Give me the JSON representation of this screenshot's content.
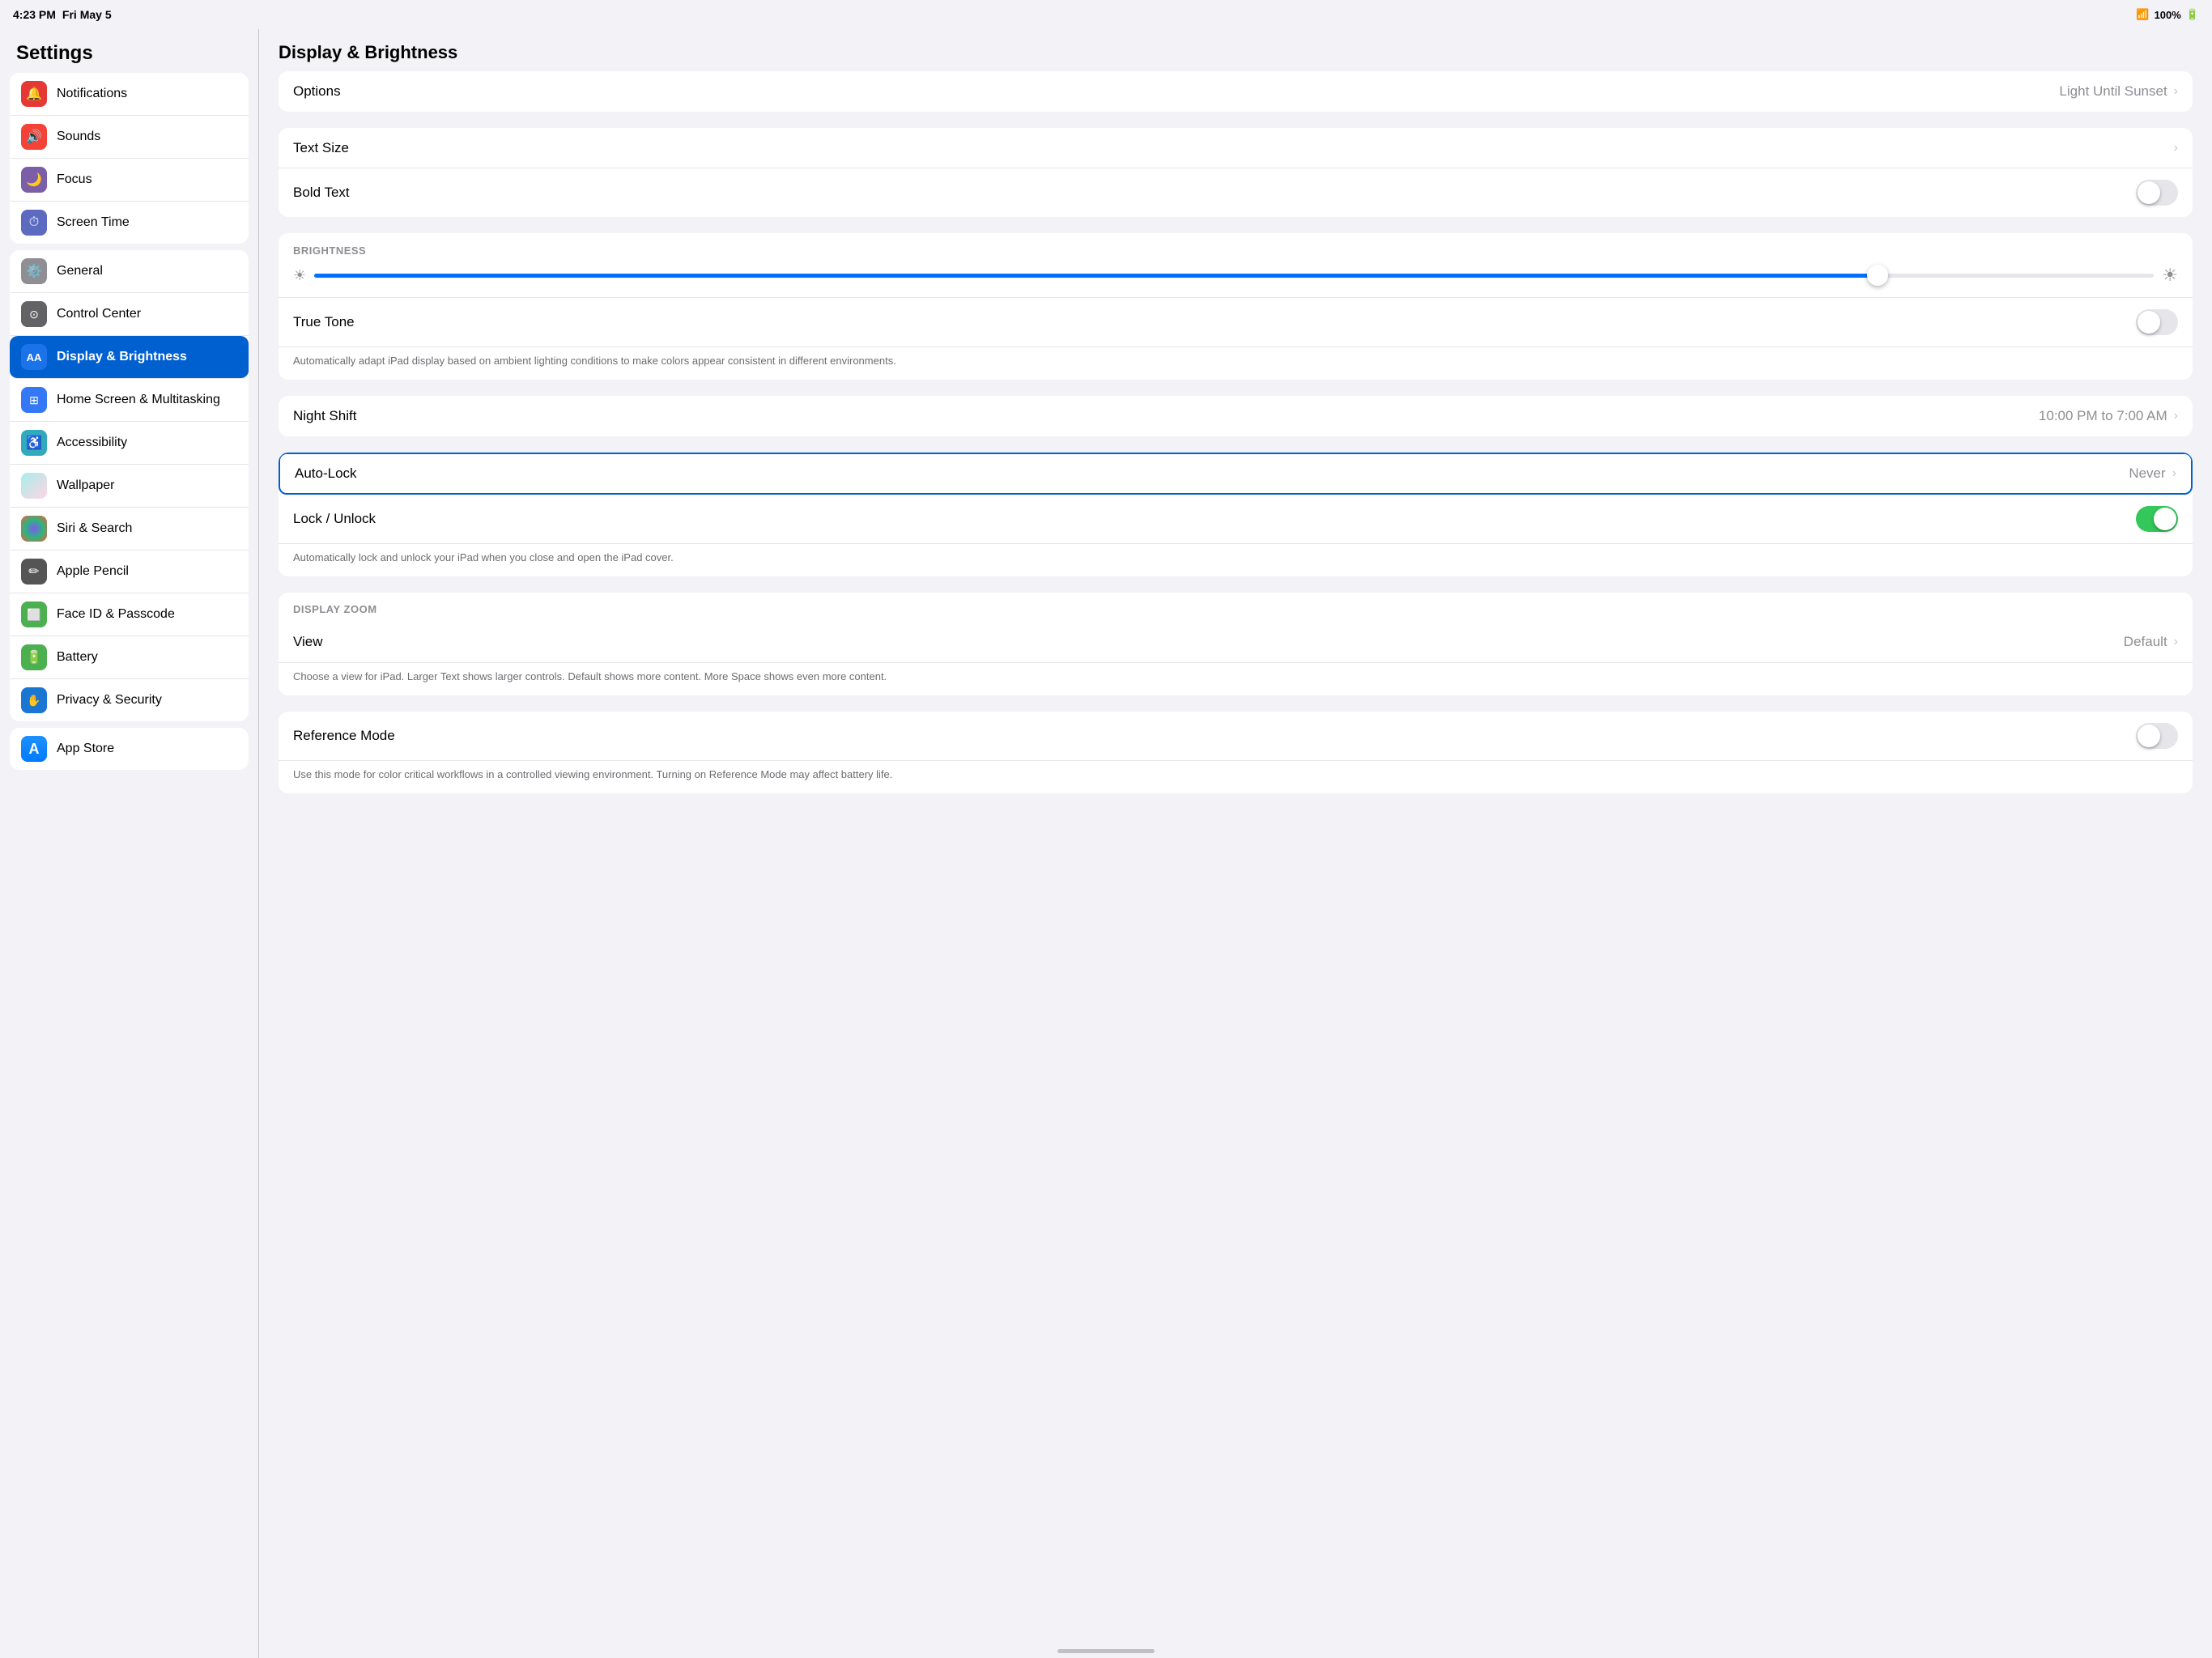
{
  "statusBar": {
    "time": "4:23 PM",
    "date": "Fri May 5",
    "wifi": "wifi",
    "battery": "100%"
  },
  "sidebar": {
    "title": "Settings",
    "groups": [
      {
        "id": "top",
        "items": [
          {
            "id": "notifications",
            "label": "Notifications",
            "icon": "🔔",
            "iconBg": "icon-red",
            "active": false
          },
          {
            "id": "sounds",
            "label": "Sounds",
            "icon": "🔊",
            "iconBg": "icon-orange-red",
            "active": false
          },
          {
            "id": "focus",
            "label": "Focus",
            "icon": "🌙",
            "iconBg": "icon-purple",
            "active": false
          },
          {
            "id": "screen-time",
            "label": "Screen Time",
            "icon": "⏱",
            "iconBg": "icon-indigo",
            "active": false
          }
        ]
      },
      {
        "id": "middle",
        "items": [
          {
            "id": "general",
            "label": "General",
            "icon": "⚙️",
            "iconBg": "icon-gray",
            "active": false
          },
          {
            "id": "control-center",
            "label": "Control Center",
            "icon": "◉",
            "iconBg": "icon-dark-gray",
            "active": false
          },
          {
            "id": "display-brightness",
            "label": "Display & Brightness",
            "icon": "AA",
            "iconBg": "icon-blue-aa",
            "active": true
          },
          {
            "id": "home-screen",
            "label": "Home Screen & Multitasking",
            "icon": "⊞",
            "iconBg": "icon-grid-blue",
            "active": false
          },
          {
            "id": "accessibility",
            "label": "Accessibility",
            "icon": "☺",
            "iconBg": "icon-teal",
            "active": false
          },
          {
            "id": "wallpaper",
            "label": "Wallpaper",
            "icon": "🖼",
            "iconBg": "icon-wallpaper",
            "active": false
          },
          {
            "id": "siri",
            "label": "Siri & Search",
            "icon": "◉",
            "iconBg": "icon-siri",
            "active": false
          },
          {
            "id": "apple-pencil",
            "label": "Apple Pencil",
            "icon": "✏",
            "iconBg": "icon-pencil",
            "active": false
          },
          {
            "id": "face-id",
            "label": "Face ID & Passcode",
            "icon": "◻",
            "iconBg": "icon-face-id",
            "active": false
          },
          {
            "id": "battery",
            "label": "Battery",
            "icon": "🔋",
            "iconBg": "icon-battery",
            "active": false
          },
          {
            "id": "privacy",
            "label": "Privacy & Security",
            "icon": "✋",
            "iconBg": "icon-privacy",
            "active": false
          }
        ]
      },
      {
        "id": "bottom",
        "items": [
          {
            "id": "app-store",
            "label": "App Store",
            "icon": "A",
            "iconBg": "icon-appstore",
            "active": false
          }
        ]
      }
    ]
  },
  "mainContent": {
    "title": "Display & Brightness",
    "groups": [
      {
        "id": "appearance",
        "rows": [
          {
            "id": "options",
            "label": "Options",
            "value": "Light Until Sunset",
            "hasChevron": true,
            "type": "nav"
          }
        ]
      },
      {
        "id": "text",
        "rows": [
          {
            "id": "text-size",
            "label": "Text Size",
            "value": "",
            "hasChevron": true,
            "type": "nav"
          },
          {
            "id": "bold-text",
            "label": "Bold Text",
            "value": "",
            "hasChevron": false,
            "type": "toggle",
            "toggleOn": false
          }
        ]
      },
      {
        "id": "brightness",
        "sectionLabel": "BRIGHTNESS",
        "rows": []
      },
      {
        "id": "truetone",
        "rows": [
          {
            "id": "true-tone",
            "label": "True Tone",
            "value": "",
            "hasChevron": false,
            "type": "toggle",
            "toggleOn": false
          },
          {
            "id": "true-tone-desc",
            "type": "description",
            "text": "Automatically adapt iPad display based on ambient lighting conditions to make colors appear consistent in different environments."
          }
        ]
      },
      {
        "id": "nightshift",
        "rows": [
          {
            "id": "night-shift",
            "label": "Night Shift",
            "value": "10:00 PM to 7:00 AM",
            "hasChevron": true,
            "type": "nav"
          }
        ]
      },
      {
        "id": "autolock",
        "rows": [
          {
            "id": "auto-lock",
            "label": "Auto-Lock",
            "value": "Never",
            "hasChevron": true,
            "type": "nav",
            "highlighted": true
          },
          {
            "id": "lock-unlock",
            "label": "Lock / Unlock",
            "value": "",
            "hasChevron": false,
            "type": "toggle",
            "toggleOn": true
          },
          {
            "id": "lock-unlock-desc",
            "type": "description",
            "text": "Automatically lock and unlock your iPad when you close and open the iPad cover."
          }
        ]
      },
      {
        "id": "displayzoom",
        "sectionLabel": "DISPLAY ZOOM",
        "rows": [
          {
            "id": "view",
            "label": "View",
            "value": "Default",
            "hasChevron": true,
            "type": "nav"
          },
          {
            "id": "view-desc",
            "type": "description",
            "text": "Choose a view for iPad. Larger Text shows larger controls. Default shows more content. More Space shows even more content."
          }
        ]
      },
      {
        "id": "referencemode",
        "rows": [
          {
            "id": "reference-mode",
            "label": "Reference Mode",
            "value": "",
            "hasChevron": false,
            "type": "toggle",
            "toggleOn": false
          },
          {
            "id": "reference-mode-desc",
            "type": "description",
            "text": "Use this mode for color critical workflows in a controlled viewing environment. Turning on Reference Mode may affect battery life."
          }
        ]
      }
    ]
  }
}
